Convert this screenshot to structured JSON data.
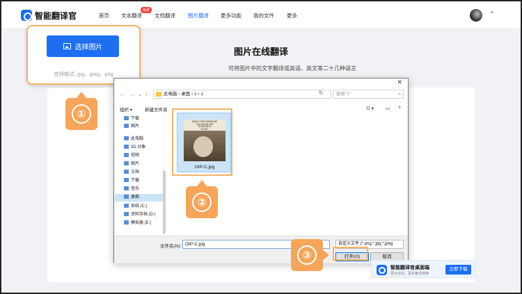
{
  "nav": {
    "brand": "智能翻译官",
    "items": [
      "首页",
      "文本翻译",
      "文档翻译",
      "图片翻译",
      "更多功能",
      "我的文件",
      "更多"
    ],
    "badge": "免费"
  },
  "page": {
    "title": "图片在线翻译",
    "subtitle": "可将图片中的文字翻译成英语、英文等二十几种语言"
  },
  "upload": {
    "button": "选择图片",
    "formats": "支持格式: jpg、jpeg、png"
  },
  "steps": [
    "①",
    "②",
    "③"
  ],
  "dialog": {
    "close": "✕",
    "path": "此电脑  ›  桌面  ›  1  ›  1",
    "search_placeholder": "搜索\"1\"",
    "toolbar": {
      "organize": "组织 ▾",
      "new_folder": "新建文件夹"
    },
    "sidebar": [
      {
        "label": "下载",
        "icon": "download-icon"
      },
      {
        "label": "图片",
        "icon": "pictures-icon"
      },
      {
        "label": "此电脑",
        "icon": "computer-icon"
      },
      {
        "label": "3D 对象",
        "icon": "cube-icon"
      },
      {
        "label": "视频",
        "icon": "video-icon"
      },
      {
        "label": "图片",
        "icon": "pictures-icon"
      },
      {
        "label": "文档",
        "icon": "document-icon"
      },
      {
        "label": "下载",
        "icon": "download-icon"
      },
      {
        "label": "音乐",
        "icon": "music-icon"
      },
      {
        "label": "桌面",
        "icon": "desktop-icon",
        "selected": true
      },
      {
        "label": "系统 (C:)",
        "icon": "drive-icon"
      },
      {
        "label": "资料存档 (D:)",
        "icon": "drive-icon"
      },
      {
        "label": "模拟器 (E:)",
        "icon": "drive-icon"
      }
    ],
    "file": {
      "name": "OIP-C.jpg",
      "caption_lines": [
        "WHEN I SEE SOMEONE",
        "YOU KNOW THE",
        "DOGS WITH",
        "IS NOT"
      ]
    },
    "filename_label": "文件名(N):",
    "filename_value": "OIP-C.jpg",
    "filetype": "自定义文件 (*.png;*.jpg;*.jpeg",
    "open_button": "打开(O)",
    "cancel_button": "取消"
  },
  "download_banner": {
    "title": "智能翻译官桌面端",
    "subtitle": "更大空间、更多格式转换",
    "button": "立即下载"
  }
}
